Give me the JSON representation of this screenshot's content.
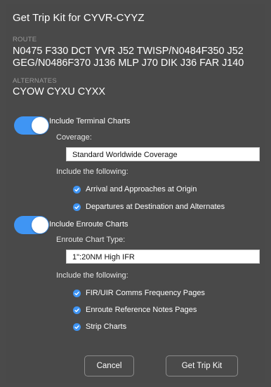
{
  "dialog": {
    "title": "Get Trip Kit for CYVR-CYYZ",
    "route_label": "ROUTE",
    "route": "N0475 F330 DCT YVR J52 TWISP/N0484F350 J52\nGEG/N0486F370 J136 MLP J70 DIK J36 FAR J140",
    "alternates_label": "ALTERNATES",
    "alternates": "CYOW CYXU CYXX"
  },
  "terminal": {
    "toggle_label": "Include Terminal Charts",
    "toggle_on": true,
    "coverage_label": "Coverage:",
    "coverage_value": "Standard Worldwide Coverage",
    "include_label": "Include the following:",
    "options": [
      {
        "label": "Arrival and Approaches at Origin",
        "checked": true
      },
      {
        "label": "Departures at Destination and Alternates",
        "checked": true
      }
    ]
  },
  "enroute": {
    "toggle_label": "Include Enroute Charts",
    "toggle_on": true,
    "type_label": "Enroute Chart Type:",
    "type_value": "1\":20NM High IFR",
    "include_label": "Include the following:",
    "options": [
      {
        "label": "FIR/UIR Comms Frequency Pages",
        "checked": true
      },
      {
        "label": "Enroute Reference Notes Pages",
        "checked": true
      },
      {
        "label": "Strip Charts",
        "checked": true
      }
    ]
  },
  "buttons": {
    "cancel": "Cancel",
    "get_trip_kit": "Get Trip Kit"
  },
  "colors": {
    "accent": "#3f95f4",
    "background": "#494949",
    "muted_text": "#9a9a9a"
  },
  "icons": {
    "toggle": "toggle-switch-on",
    "check": "check-circle-icon"
  }
}
